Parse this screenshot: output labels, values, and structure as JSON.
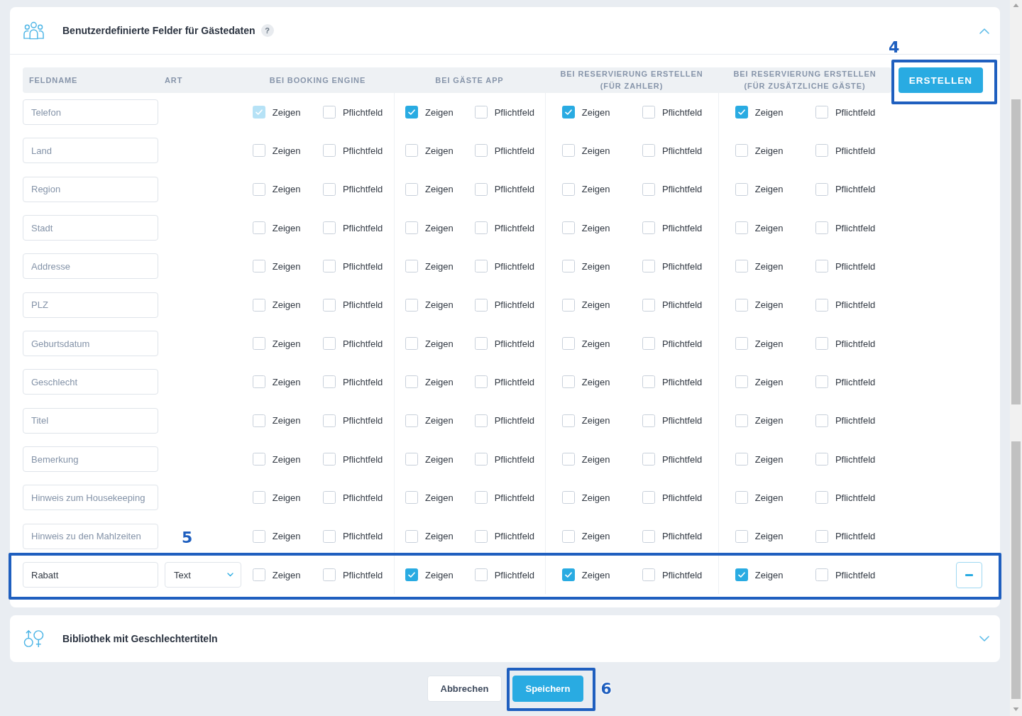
{
  "sections": [
    {
      "kind": "fields",
      "title": "Benutzerdefinierte Felder für Gästedaten",
      "help": "?",
      "expanded": true,
      "table": {
        "columns": [
          {
            "label": "FELDNAME"
          },
          {
            "label": "ART"
          },
          {
            "label": "BEI BOOKING ENGINE"
          },
          {
            "label": "BEI GÄSTE APP"
          },
          {
            "label": "BEI RESERVIERUNG ERSTELLEN (FÜR ZAHLER)"
          },
          {
            "label": "BEI RESERVIERUNG ERSTELLEN (FÜR ZUSÄTZLICHE GÄSTE)"
          }
        ],
        "create_button": {
          "label": "ERSTELLEN",
          "callout": "4"
        },
        "rows": [
          {
            "field": {
              "value": "Telefon",
              "disabled": true
            },
            "removable": false,
            "groups": [
              {
                "options": [
                  {
                    "label": "Zeigen",
                    "checked": true,
                    "disabled": true
                  },
                  {
                    "label": "Pflichtfeld",
                    "checked": false,
                    "disabled": false
                  }
                ]
              },
              {
                "options": [
                  {
                    "label": "Zeigen",
                    "checked": true,
                    "disabled": false
                  },
                  {
                    "label": "Pflichtfeld",
                    "checked": false,
                    "disabled": false
                  }
                ]
              },
              {
                "options": [
                  {
                    "label": "Zeigen",
                    "checked": true,
                    "disabled": false
                  },
                  {
                    "label": "Pflichtfeld",
                    "checked": false,
                    "disabled": false
                  }
                ]
              },
              {
                "options": [
                  {
                    "label": "Zeigen",
                    "checked": true,
                    "disabled": false
                  },
                  {
                    "label": "Pflichtfeld",
                    "checked": false,
                    "disabled": false
                  }
                ]
              }
            ]
          },
          {
            "field": {
              "value": "Land",
              "disabled": true
            },
            "removable": false,
            "groups": [
              {
                "options": [
                  {
                    "label": "Zeigen",
                    "checked": false,
                    "disabled": false
                  },
                  {
                    "label": "Pflichtfeld",
                    "checked": false,
                    "disabled": false
                  }
                ]
              },
              {
                "options": [
                  {
                    "label": "Zeigen",
                    "checked": false,
                    "disabled": false
                  },
                  {
                    "label": "Pflichtfeld",
                    "checked": false,
                    "disabled": false
                  }
                ]
              },
              {
                "options": [
                  {
                    "label": "Zeigen",
                    "checked": false,
                    "disabled": false
                  },
                  {
                    "label": "Pflichtfeld",
                    "checked": false,
                    "disabled": false
                  }
                ]
              },
              {
                "options": [
                  {
                    "label": "Zeigen",
                    "checked": false,
                    "disabled": false
                  },
                  {
                    "label": "Pflichtfeld",
                    "checked": false,
                    "disabled": false
                  }
                ]
              }
            ]
          },
          {
            "field": {
              "value": "Region",
              "disabled": true
            },
            "removable": false,
            "groups": [
              {
                "options": [
                  {
                    "label": "Zeigen",
                    "checked": false,
                    "disabled": false
                  },
                  {
                    "label": "Pflichtfeld",
                    "checked": false,
                    "disabled": false
                  }
                ]
              },
              {
                "options": [
                  {
                    "label": "Zeigen",
                    "checked": false,
                    "disabled": false
                  },
                  {
                    "label": "Pflichtfeld",
                    "checked": false,
                    "disabled": false
                  }
                ]
              },
              {
                "options": [
                  {
                    "label": "Zeigen",
                    "checked": false,
                    "disabled": false
                  },
                  {
                    "label": "Pflichtfeld",
                    "checked": false,
                    "disabled": false
                  }
                ]
              },
              {
                "options": [
                  {
                    "label": "Zeigen",
                    "checked": false,
                    "disabled": false
                  },
                  {
                    "label": "Pflichtfeld",
                    "checked": false,
                    "disabled": false
                  }
                ]
              }
            ]
          },
          {
            "field": {
              "value": "Stadt",
              "disabled": true
            },
            "removable": false,
            "groups": [
              {
                "options": [
                  {
                    "label": "Zeigen",
                    "checked": false,
                    "disabled": false
                  },
                  {
                    "label": "Pflichtfeld",
                    "checked": false,
                    "disabled": false
                  }
                ]
              },
              {
                "options": [
                  {
                    "label": "Zeigen",
                    "checked": false,
                    "disabled": false
                  },
                  {
                    "label": "Pflichtfeld",
                    "checked": false,
                    "disabled": false
                  }
                ]
              },
              {
                "options": [
                  {
                    "label": "Zeigen",
                    "checked": false,
                    "disabled": false
                  },
                  {
                    "label": "Pflichtfeld",
                    "checked": false,
                    "disabled": false
                  }
                ]
              },
              {
                "options": [
                  {
                    "label": "Zeigen",
                    "checked": false,
                    "disabled": false
                  },
                  {
                    "label": "Pflichtfeld",
                    "checked": false,
                    "disabled": false
                  }
                ]
              }
            ]
          },
          {
            "field": {
              "value": "Addresse",
              "disabled": true
            },
            "removable": false,
            "groups": [
              {
                "options": [
                  {
                    "label": "Zeigen",
                    "checked": false,
                    "disabled": false
                  },
                  {
                    "label": "Pflichtfeld",
                    "checked": false,
                    "disabled": false
                  }
                ]
              },
              {
                "options": [
                  {
                    "label": "Zeigen",
                    "checked": false,
                    "disabled": false
                  },
                  {
                    "label": "Pflichtfeld",
                    "checked": false,
                    "disabled": false
                  }
                ]
              },
              {
                "options": [
                  {
                    "label": "Zeigen",
                    "checked": false,
                    "disabled": false
                  },
                  {
                    "label": "Pflichtfeld",
                    "checked": false,
                    "disabled": false
                  }
                ]
              },
              {
                "options": [
                  {
                    "label": "Zeigen",
                    "checked": false,
                    "disabled": false
                  },
                  {
                    "label": "Pflichtfeld",
                    "checked": false,
                    "disabled": false
                  }
                ]
              }
            ]
          },
          {
            "field": {
              "value": "PLZ",
              "disabled": true
            },
            "removable": false,
            "groups": [
              {
                "options": [
                  {
                    "label": "Zeigen",
                    "checked": false,
                    "disabled": false
                  },
                  {
                    "label": "Pflichtfeld",
                    "checked": false,
                    "disabled": false
                  }
                ]
              },
              {
                "options": [
                  {
                    "label": "Zeigen",
                    "checked": false,
                    "disabled": false
                  },
                  {
                    "label": "Pflichtfeld",
                    "checked": false,
                    "disabled": false
                  }
                ]
              },
              {
                "options": [
                  {
                    "label": "Zeigen",
                    "checked": false,
                    "disabled": false
                  },
                  {
                    "label": "Pflichtfeld",
                    "checked": false,
                    "disabled": false
                  }
                ]
              },
              {
                "options": [
                  {
                    "label": "Zeigen",
                    "checked": false,
                    "disabled": false
                  },
                  {
                    "label": "Pflichtfeld",
                    "checked": false,
                    "disabled": false
                  }
                ]
              }
            ]
          },
          {
            "field": {
              "value": "Geburtsdatum",
              "disabled": true
            },
            "removable": false,
            "groups": [
              {
                "options": [
                  {
                    "label": "Zeigen",
                    "checked": false,
                    "disabled": false
                  },
                  {
                    "label": "Pflichtfeld",
                    "checked": false,
                    "disabled": false
                  }
                ]
              },
              {
                "options": [
                  {
                    "label": "Zeigen",
                    "checked": false,
                    "disabled": false
                  },
                  {
                    "label": "Pflichtfeld",
                    "checked": false,
                    "disabled": false
                  }
                ]
              },
              {
                "options": [
                  {
                    "label": "Zeigen",
                    "checked": false,
                    "disabled": false
                  },
                  {
                    "label": "Pflichtfeld",
                    "checked": false,
                    "disabled": false
                  }
                ]
              },
              {
                "options": [
                  {
                    "label": "Zeigen",
                    "checked": false,
                    "disabled": false
                  },
                  {
                    "label": "Pflichtfeld",
                    "checked": false,
                    "disabled": false
                  }
                ]
              }
            ]
          },
          {
            "field": {
              "value": "Geschlecht",
              "disabled": true
            },
            "removable": false,
            "groups": [
              {
                "options": [
                  {
                    "label": "Zeigen",
                    "checked": false,
                    "disabled": false
                  },
                  {
                    "label": "Pflichtfeld",
                    "checked": false,
                    "disabled": false
                  }
                ]
              },
              {
                "options": [
                  {
                    "label": "Zeigen",
                    "checked": false,
                    "disabled": false
                  },
                  {
                    "label": "Pflichtfeld",
                    "checked": false,
                    "disabled": false
                  }
                ]
              },
              {
                "options": [
                  {
                    "label": "Zeigen",
                    "checked": false,
                    "disabled": false
                  },
                  {
                    "label": "Pflichtfeld",
                    "checked": false,
                    "disabled": false
                  }
                ]
              },
              {
                "options": [
                  {
                    "label": "Zeigen",
                    "checked": false,
                    "disabled": false
                  },
                  {
                    "label": "Pflichtfeld",
                    "checked": false,
                    "disabled": false
                  }
                ]
              }
            ]
          },
          {
            "field": {
              "value": "Titel",
              "disabled": true
            },
            "removable": false,
            "groups": [
              {
                "options": [
                  {
                    "label": "Zeigen",
                    "checked": false,
                    "disabled": false
                  },
                  {
                    "label": "Pflichtfeld",
                    "checked": false,
                    "disabled": false
                  }
                ]
              },
              {
                "options": [
                  {
                    "label": "Zeigen",
                    "checked": false,
                    "disabled": false
                  },
                  {
                    "label": "Pflichtfeld",
                    "checked": false,
                    "disabled": false
                  }
                ]
              },
              {
                "options": [
                  {
                    "label": "Zeigen",
                    "checked": false,
                    "disabled": false
                  },
                  {
                    "label": "Pflichtfeld",
                    "checked": false,
                    "disabled": false
                  }
                ]
              },
              {
                "options": [
                  {
                    "label": "Zeigen",
                    "checked": false,
                    "disabled": false
                  },
                  {
                    "label": "Pflichtfeld",
                    "checked": false,
                    "disabled": false
                  }
                ]
              }
            ]
          },
          {
            "field": {
              "value": "Bemerkung",
              "disabled": true
            },
            "removable": false,
            "groups": [
              {
                "options": [
                  {
                    "label": "Zeigen",
                    "checked": false,
                    "disabled": false
                  },
                  {
                    "label": "Pflichtfeld",
                    "checked": false,
                    "disabled": false
                  }
                ]
              },
              {
                "options": [
                  {
                    "label": "Zeigen",
                    "checked": false,
                    "disabled": false
                  },
                  {
                    "label": "Pflichtfeld",
                    "checked": false,
                    "disabled": false
                  }
                ]
              },
              {
                "options": [
                  {
                    "label": "Zeigen",
                    "checked": false,
                    "disabled": false
                  },
                  {
                    "label": "Pflichtfeld",
                    "checked": false,
                    "disabled": false
                  }
                ]
              },
              {
                "options": [
                  {
                    "label": "Zeigen",
                    "checked": false,
                    "disabled": false
                  },
                  {
                    "label": "Pflichtfeld",
                    "checked": false,
                    "disabled": false
                  }
                ]
              }
            ]
          },
          {
            "field": {
              "value": "Hinweis zum Housekeeping",
              "disabled": true
            },
            "removable": false,
            "groups": [
              {
                "options": [
                  {
                    "label": "Zeigen",
                    "checked": false,
                    "disabled": false
                  },
                  {
                    "label": "Pflichtfeld",
                    "checked": false,
                    "disabled": false
                  }
                ]
              },
              {
                "options": [
                  {
                    "label": "Zeigen",
                    "checked": false,
                    "disabled": false
                  },
                  {
                    "label": "Pflichtfeld",
                    "checked": false,
                    "disabled": false
                  }
                ]
              },
              {
                "options": [
                  {
                    "label": "Zeigen",
                    "checked": false,
                    "disabled": false
                  },
                  {
                    "label": "Pflichtfeld",
                    "checked": false,
                    "disabled": false
                  }
                ]
              },
              {
                "options": [
                  {
                    "label": "Zeigen",
                    "checked": false,
                    "disabled": false
                  },
                  {
                    "label": "Pflichtfeld",
                    "checked": false,
                    "disabled": false
                  }
                ]
              }
            ]
          },
          {
            "field": {
              "value": "Hinweis zu den Mahlzeiten",
              "disabled": true
            },
            "removable": false,
            "groups": [
              {
                "options": [
                  {
                    "label": "Zeigen",
                    "checked": false,
                    "disabled": false
                  },
                  {
                    "label": "Pflichtfeld",
                    "checked": false,
                    "disabled": false
                  }
                ]
              },
              {
                "options": [
                  {
                    "label": "Zeigen",
                    "checked": false,
                    "disabled": false
                  },
                  {
                    "label": "Pflichtfeld",
                    "checked": false,
                    "disabled": false
                  }
                ]
              },
              {
                "options": [
                  {
                    "label": "Zeigen",
                    "checked": false,
                    "disabled": false
                  },
                  {
                    "label": "Pflichtfeld",
                    "checked": false,
                    "disabled": false
                  }
                ]
              },
              {
                "options": [
                  {
                    "label": "Zeigen",
                    "checked": false,
                    "disabled": false
                  },
                  {
                    "label": "Pflichtfeld",
                    "checked": false,
                    "disabled": false
                  }
                ]
              }
            ]
          },
          {
            "field": {
              "value": "Rabatt",
              "disabled": false
            },
            "type": {
              "value": "Text"
            },
            "removable": true,
            "callout": "5",
            "groups": [
              {
                "options": [
                  {
                    "label": "Zeigen",
                    "checked": false,
                    "disabled": false
                  },
                  {
                    "label": "Pflichtfeld",
                    "checked": false,
                    "disabled": false
                  }
                ]
              },
              {
                "options": [
                  {
                    "label": "Zeigen",
                    "checked": true,
                    "disabled": false
                  },
                  {
                    "label": "Pflichtfeld",
                    "checked": false,
                    "disabled": false
                  }
                ]
              },
              {
                "options": [
                  {
                    "label": "Zeigen",
                    "checked": true,
                    "disabled": false
                  },
                  {
                    "label": "Pflichtfeld",
                    "checked": false,
                    "disabled": false
                  }
                ]
              },
              {
                "options": [
                  {
                    "label": "Zeigen",
                    "checked": true,
                    "disabled": false
                  },
                  {
                    "label": "Pflichtfeld",
                    "checked": false,
                    "disabled": false
                  }
                ]
              }
            ]
          }
        ]
      }
    },
    {
      "kind": "library",
      "title": "Bibliothek mit Geschlechtertiteln",
      "expanded": false
    }
  ],
  "footer": {
    "buttons": [
      {
        "label": "Abbrechen",
        "kind": "secondary"
      },
      {
        "label": "Speichern",
        "kind": "primary",
        "callout": "6"
      }
    ]
  }
}
